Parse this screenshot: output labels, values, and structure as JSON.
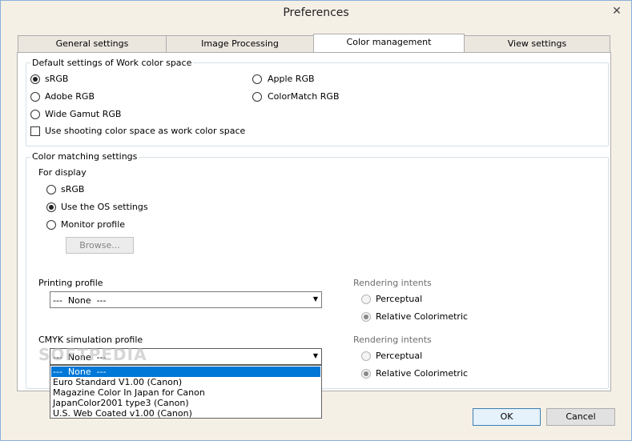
{
  "window": {
    "title": "Preferences",
    "close_glyph": "✕"
  },
  "tabs": [
    {
      "label": "General settings"
    },
    {
      "label": "Image Processing"
    },
    {
      "label": "Color management"
    },
    {
      "label": "View settings"
    }
  ],
  "work_space": {
    "title": "Default settings of Work color space",
    "options": [
      {
        "label": "sRGB",
        "selected": true
      },
      {
        "label": "Apple RGB",
        "selected": false
      },
      {
        "label": "Adobe RGB",
        "selected": false
      },
      {
        "label": "ColorMatch RGB",
        "selected": false
      },
      {
        "label": "Wide Gamut RGB",
        "selected": false
      }
    ],
    "shooting_checkbox": {
      "label": "Use shooting color space as work color space",
      "checked": false
    }
  },
  "matching": {
    "title": "Color matching settings",
    "for_display": "For display",
    "display_options": [
      {
        "label": "sRGB",
        "selected": false
      },
      {
        "label": "Use the OS settings",
        "selected": true
      },
      {
        "label": "Monitor profile",
        "selected": false
      }
    ],
    "browse_label": "Browse...",
    "printing_label": "Printing profile",
    "printing_value": "---  None  ---",
    "cmyk_label": "CMYK simulation profile",
    "cmyk_value": "---  None  ---",
    "rendering_label_1": "Rendering intents",
    "rendering_label_2": "Rendering intents",
    "perceptual_1": "Perceptual",
    "relative_1": "Relative Colorimetric",
    "perceptual_2": "Perceptual",
    "relative_2": "Relative Colorimetric",
    "dropdown_options": [
      "---  None  ---",
      "Euro Standard V1.00 (Canon)",
      "Magazine Color In Japan for Canon",
      "JapanColor2001 type3 (Canon)",
      "U.S. Web Coated v1.00 (Canon)"
    ]
  },
  "footer": {
    "ok": "OK",
    "cancel": "Cancel"
  },
  "watermark": "SOFTPEDIA"
}
